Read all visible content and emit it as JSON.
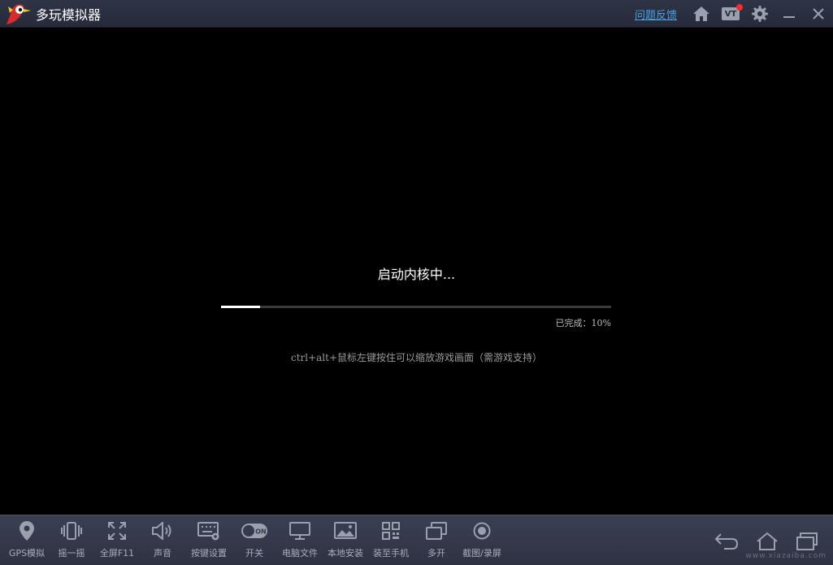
{
  "titlebar": {
    "app_title": "多玩模拟器",
    "feedback_label": "问题反馈",
    "vt_label": "VT"
  },
  "screen": {
    "loading_text": "启动内核中...",
    "progress_percent": 10,
    "progress_text": "已完成：10%",
    "hint": "ctrl+alt+鼠标左键按住可以缩放游戏画面（需游戏支持）"
  },
  "toolbar": {
    "items": [
      {
        "label": "GPS模拟",
        "icon": "location-pin-icon"
      },
      {
        "label": "摇一摇",
        "icon": "shake-phone-icon"
      },
      {
        "label": "全屏F11",
        "icon": "fullscreen-icon"
      },
      {
        "label": "声音",
        "icon": "speaker-icon"
      },
      {
        "label": "按键设置",
        "icon": "keyboard-settings-icon"
      },
      {
        "label": "开关",
        "icon": "toggle-on-icon",
        "toggle_text": "ON"
      },
      {
        "label": "电脑文件",
        "icon": "monitor-icon"
      },
      {
        "label": "本地安装",
        "icon": "image-install-icon"
      },
      {
        "label": "装至手机",
        "icon": "qrcode-icon"
      },
      {
        "label": "多开",
        "icon": "multi-window-icon"
      },
      {
        "label": "截图/录屏",
        "icon": "record-icon"
      }
    ]
  },
  "watermark": "www.xiazaiba.com",
  "colors": {
    "titlebar_bg": "#2b2f40",
    "toolbar_bg": "#353a4c",
    "link": "#4aa3e8",
    "progress_fill": "#ffffff",
    "badge_dot": "#ff2a2a"
  }
}
